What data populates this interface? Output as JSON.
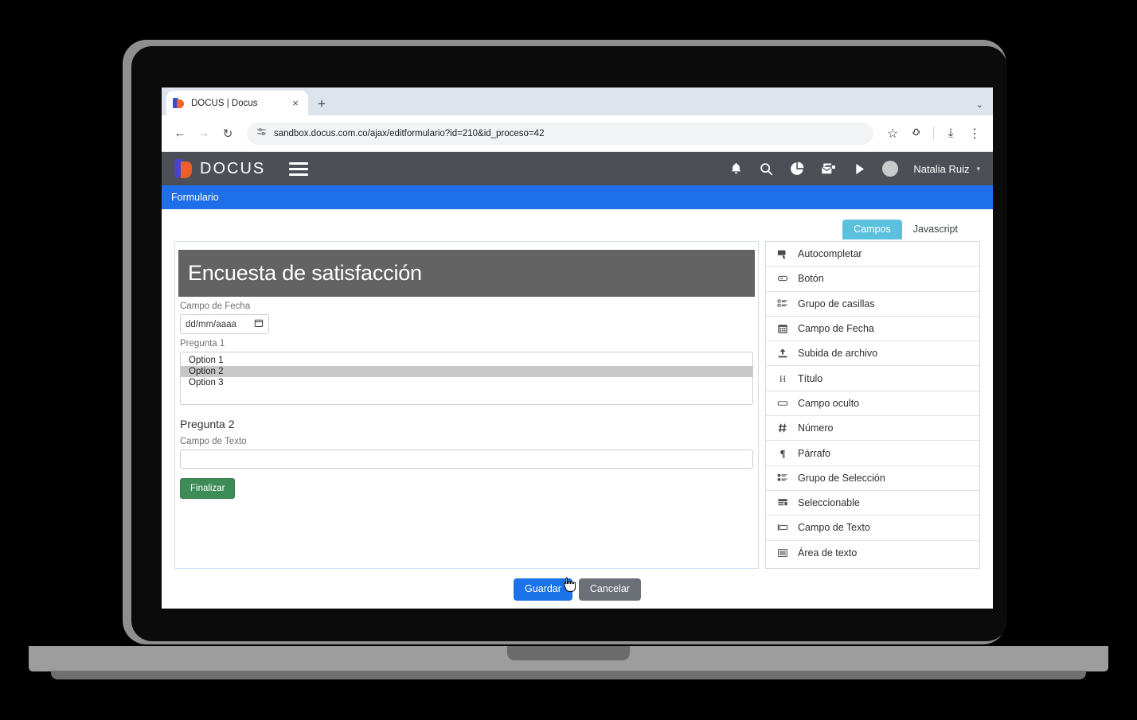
{
  "browser": {
    "tab": {
      "title": "DOCUS | Docus",
      "favicon": "docus-logo-icon",
      "close": "×"
    },
    "new_tab": "+",
    "tabstrip_chevron": "⌄",
    "nav": {
      "back": "←",
      "forward": "→",
      "reload": "↻"
    },
    "omnibox": {
      "site_info_icon": "tune-icon",
      "url": "sandbox.docus.com.co/ajax/editformulario?id=210&id_proceso=42"
    },
    "actions": {
      "bookmark": "☆",
      "extensions": "puzzle-icon",
      "download": "⤓",
      "menu": "⋮"
    }
  },
  "app": {
    "brand": "DOCUS",
    "menu_icon": "hamburger-icon",
    "header_icons": [
      "bell-icon",
      "search-icon",
      "pie-chart-icon",
      "inbox-icon",
      "play-icon"
    ],
    "user": {
      "name": "Natalia Ruiz",
      "caret": "▾"
    },
    "breadcrumb": "Formulario",
    "colors": {
      "appbar": "#4c4f56",
      "breadcrumb": "#1f6feb",
      "tab_active": "#5bc0de",
      "form_title_bar": "#636363",
      "primary_button": "#1a73e8",
      "finalizar_button": "#3d8b57"
    }
  },
  "tabs": [
    {
      "label": "Campos",
      "active": true
    },
    {
      "label": "Javascript",
      "active": false
    }
  ],
  "form": {
    "title": "Encuesta de satisfacción",
    "fields": [
      {
        "type": "date",
        "label": "Campo de Fecha",
        "placeholder": "dd/mm/aaaa",
        "icon": "calendar-icon"
      },
      {
        "type": "listbox",
        "label": "Pregunta 1",
        "options": [
          "Option 1",
          "Option 2",
          "Option 3"
        ],
        "selected": "Option 2"
      },
      {
        "type": "heading",
        "label": "Pregunta 2"
      },
      {
        "type": "text",
        "label": "Campo de Texto",
        "value": ""
      }
    ],
    "submit_label": "Finalizar"
  },
  "palette": {
    "items": [
      {
        "label": "Autocompletar",
        "icon": "autocomplete-icon"
      },
      {
        "label": "Botón",
        "icon": "button-icon"
      },
      {
        "label": "Grupo de casillas",
        "icon": "checkbox-group-icon"
      },
      {
        "label": "Campo de Fecha",
        "icon": "calendar-icon"
      },
      {
        "label": "Subida de archivo",
        "icon": "file-upload-icon"
      },
      {
        "label": "Título",
        "icon": "heading-h-icon"
      },
      {
        "label": "Campo oculto",
        "icon": "hidden-field-icon"
      },
      {
        "label": "Número",
        "icon": "number-hash-icon"
      },
      {
        "label": "Párrafo",
        "icon": "paragraph-pilcrow-icon"
      },
      {
        "label": "Grupo de Selección",
        "icon": "radio-group-icon"
      },
      {
        "label": "Seleccionable",
        "icon": "select-icon"
      },
      {
        "label": "Campo de Texto",
        "icon": "text-field-icon"
      },
      {
        "label": "Área de texto",
        "icon": "textarea-icon"
      }
    ]
  },
  "footer_actions": {
    "save": "Guardar",
    "cancel": "Cancelar"
  }
}
